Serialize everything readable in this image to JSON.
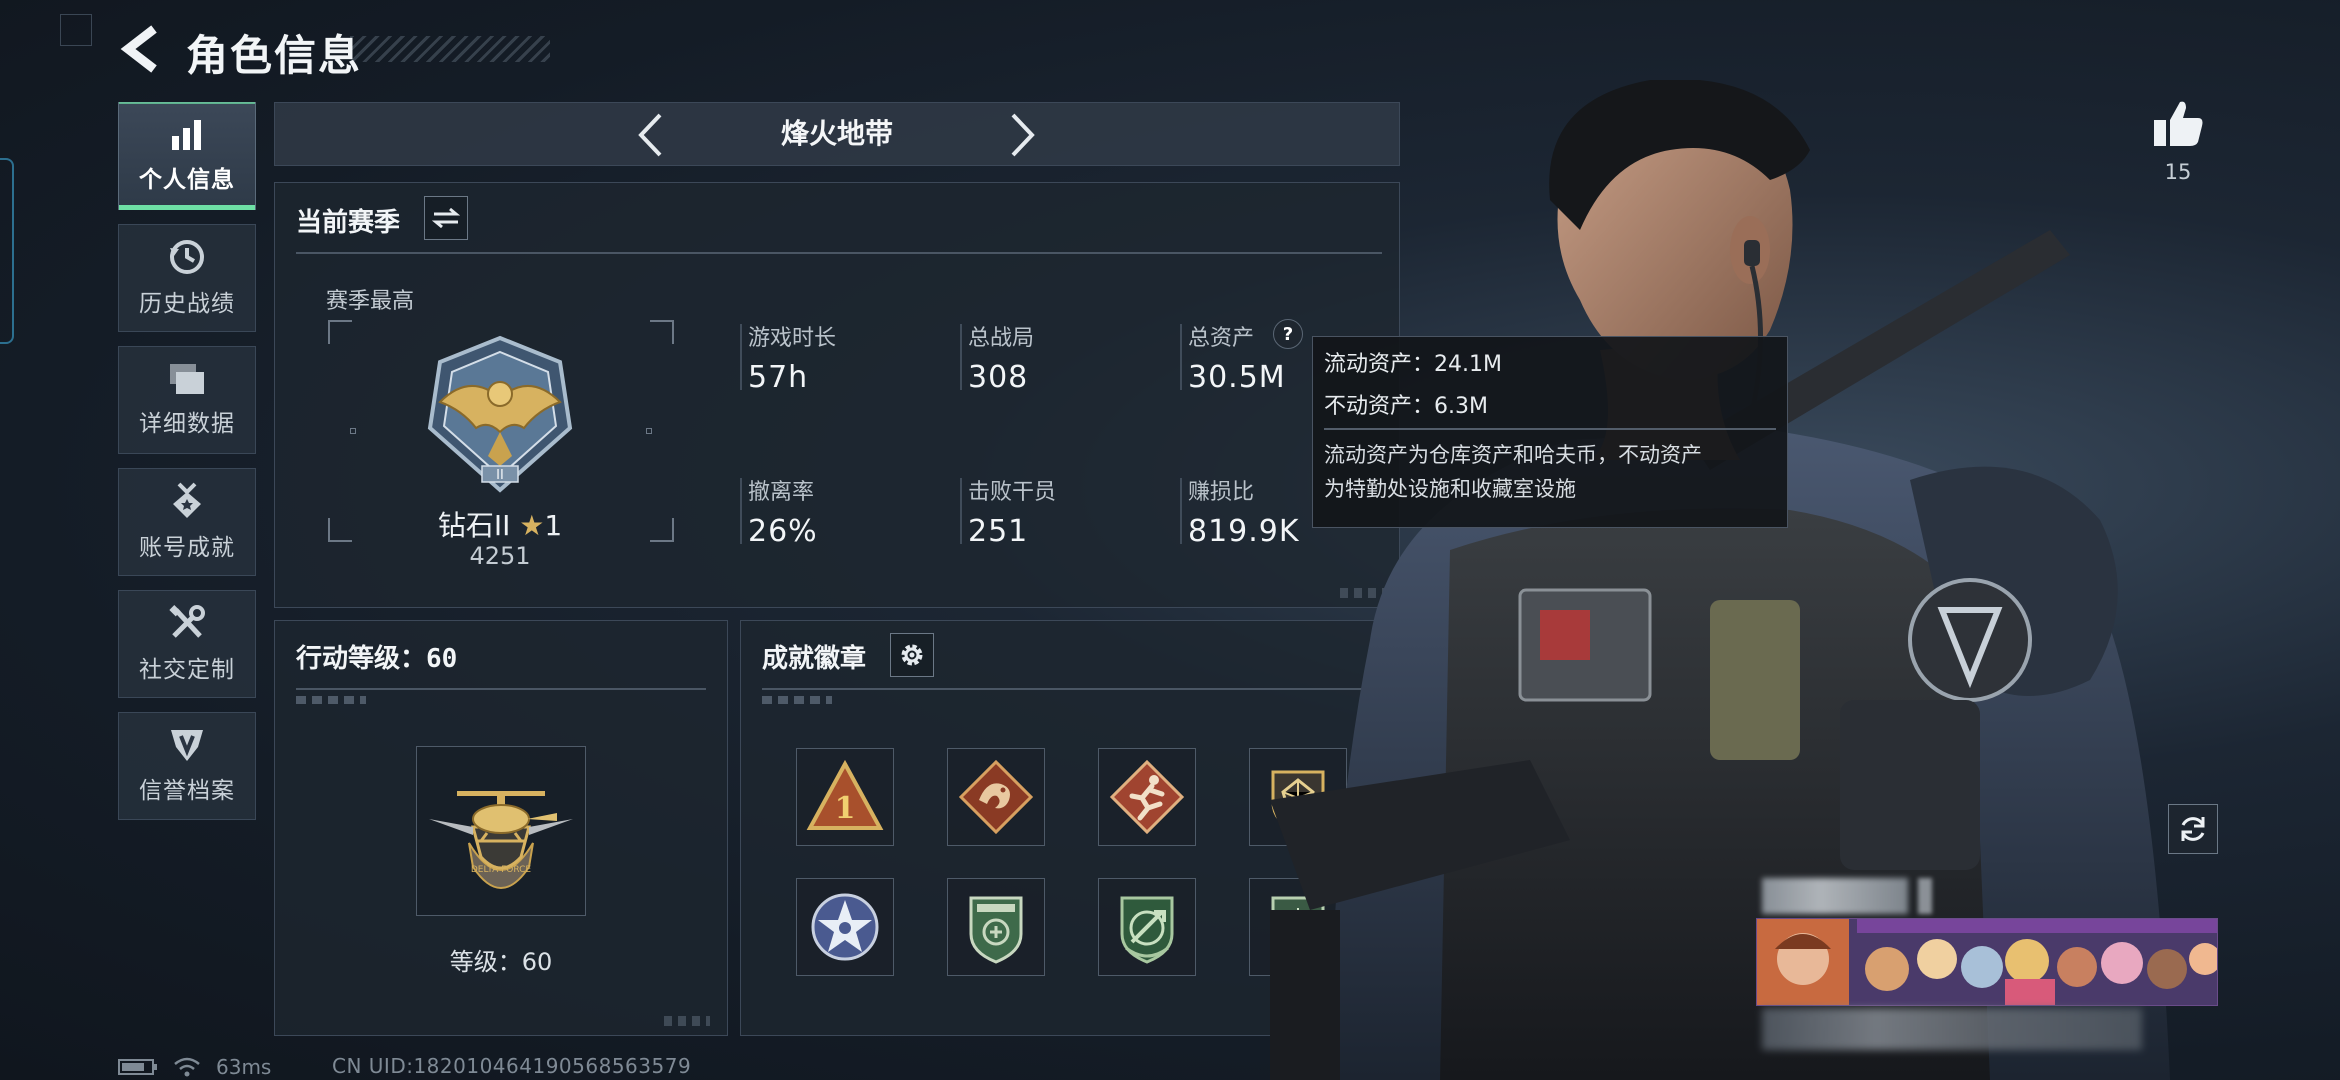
{
  "header": {
    "title": "角色信息"
  },
  "nav": {
    "items": [
      {
        "label": "个人信息",
        "icon": "bar-chart-icon",
        "active": true
      },
      {
        "label": "历史战绩",
        "icon": "history-icon",
        "active": false
      },
      {
        "label": "详细数据",
        "icon": "folders-icon",
        "active": false
      },
      {
        "label": "账号成就",
        "icon": "medal-icon",
        "active": false
      },
      {
        "label": "社交定制",
        "icon": "tools-icon",
        "active": false
      },
      {
        "label": "信誉档案",
        "icon": "shield-emblem-icon",
        "active": false
      }
    ]
  },
  "mode": {
    "title": "烽火地带"
  },
  "season": {
    "title": "当前赛季",
    "best_label": "赛季最高",
    "rank_name": "钻石II",
    "rank_stars": "1",
    "rank_score": "4251",
    "stats": [
      {
        "label": "游戏时长",
        "value": "57h"
      },
      {
        "label": "总战局",
        "value": "308"
      },
      {
        "label": "总资产",
        "value": "30.5M"
      },
      {
        "label": "撤离率",
        "value": "26%"
      },
      {
        "label": "击败干员",
        "value": "251"
      },
      {
        "label": "赚损比",
        "value": "819.9K"
      }
    ],
    "help_icon": "?"
  },
  "tooltip": {
    "liquid": "流动资产：24.1M",
    "fixed": "不动资产：6.3M",
    "desc_line1": "流动资产为仓库资产和哈夫币，不动资产",
    "desc_line2": "为特勤处设施和收藏室设施"
  },
  "level": {
    "title_prefix": "行动等级：",
    "title_value": "60",
    "caption": "等级：60"
  },
  "achievements": {
    "title": "成就徽章",
    "badges": [
      "triangle-1-badge",
      "dragon-badge",
      "runner-badge",
      "pentagon-badge",
      "star-wreath-badge",
      "green-shield-badge",
      "rifle-shield-badge",
      "crosshair-shield-badge"
    ]
  },
  "social": {
    "like_count": "15"
  },
  "status_bar": {
    "ping": "63ms",
    "uid": "CN UID:182010464190568563579"
  },
  "colors": {
    "accent": "#6ee0a5",
    "panel": "#1e2630",
    "gold": "#d7b260"
  }
}
